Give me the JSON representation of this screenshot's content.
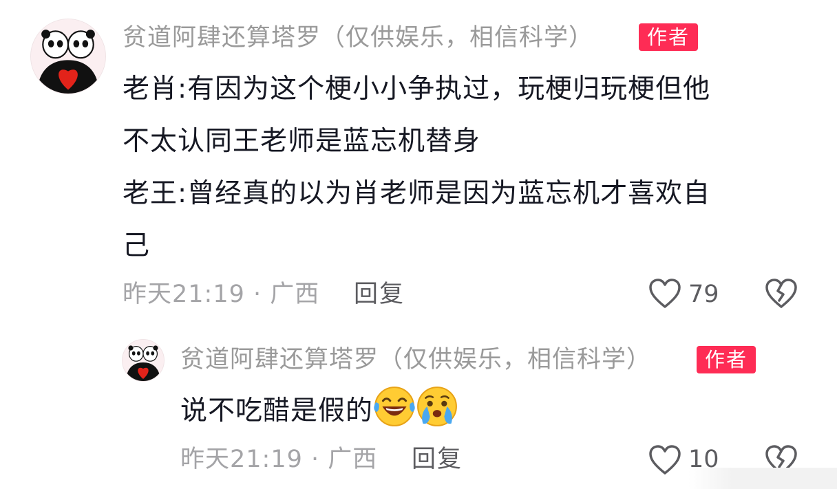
{
  "comments": [
    {
      "username": "贫道阿肆还算塔罗（仅供娱乐，相信科学）",
      "badge": "作者",
      "lines": [
        "老肖:有因为这个梗小小争执过，玩梗归玩梗但他",
        "不太认同王老师是蓝忘机替身",
        "老王:曾经真的以为肖老师是因为蓝忘机才喜欢自",
        "己"
      ],
      "meta": "昨天21:19 · 广西",
      "reply_label": "回复",
      "likes": "79",
      "like_icon": "heart-outline-icon",
      "dislike_icon": "broken-heart-icon"
    },
    {
      "username": "贫道阿肆还算塔罗（仅供娱乐，相信科学）",
      "badge": "作者",
      "text": "说不吃醋是假的",
      "emojis": [
        "laughing-crying-emoji-icon",
        "crying-emoji-icon"
      ],
      "meta": "昨天21:19 · 广西",
      "reply_label": "回复",
      "likes": "10",
      "like_icon": "heart-outline-icon",
      "dislike_icon": "broken-heart-icon"
    }
  ],
  "colors": {
    "badge_bg": "#fe2c55",
    "username": "#9a9a9a",
    "body_text": "#161823",
    "meta_text": "#a4a4a7",
    "action_text": "#5c5c60"
  }
}
